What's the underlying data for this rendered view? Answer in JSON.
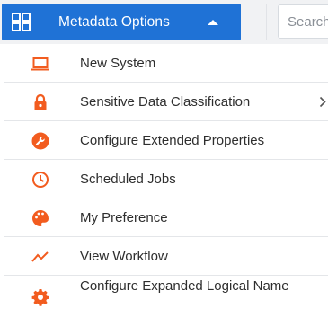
{
  "header": {
    "menu_button_label": "Metadata Options",
    "search_placeholder": "Search"
  },
  "menu": {
    "items": [
      {
        "label": "New System",
        "icon": "laptop-icon",
        "has_submenu": false
      },
      {
        "label": "Sensitive Data Classification",
        "icon": "lock-icon",
        "has_submenu": true
      },
      {
        "label": "Configure Extended Properties",
        "icon": "wrench-icon",
        "has_submenu": false
      },
      {
        "label": "Scheduled Jobs",
        "icon": "clock-icon",
        "has_submenu": false
      },
      {
        "label": "My Preference",
        "icon": "palette-icon",
        "has_submenu": false
      },
      {
        "label": "View Workflow",
        "icon": "trend-line-icon",
        "has_submenu": false
      },
      {
        "label": "Configure Expanded Logical Name",
        "icon": "gear-icon",
        "has_submenu": false
      }
    ]
  },
  "colors": {
    "accent": "#1f72d6",
    "icon": "#f25c1f",
    "divider": "#e4e6e9"
  }
}
